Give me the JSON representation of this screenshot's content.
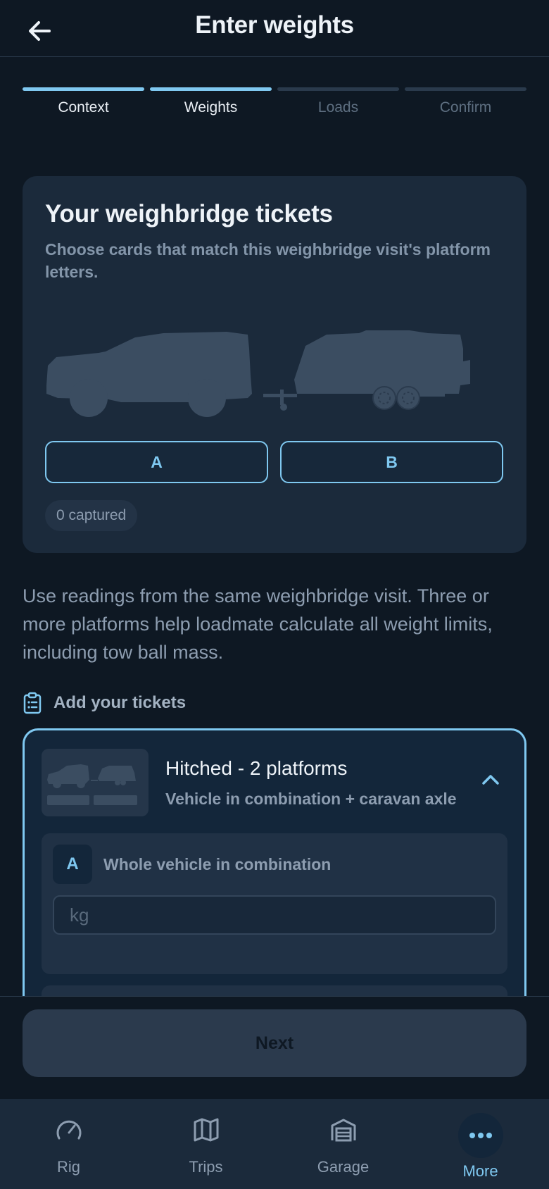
{
  "header": {
    "title": "Enter weights",
    "back_icon": "arrow-left-icon"
  },
  "stepper": {
    "steps": [
      {
        "label": "Context",
        "active": true
      },
      {
        "label": "Weights",
        "active": true
      },
      {
        "label": "Loads",
        "active": false
      },
      {
        "label": "Confirm",
        "active": false
      }
    ]
  },
  "tickets_card": {
    "title": "Your weighbridge tickets",
    "subtitle": "Choose cards that match this weighbridge visit's platform letters.",
    "platforms": [
      "A",
      "B"
    ],
    "captured": "0 captured"
  },
  "info_text": "Use readings from the same weighbridge visit. Three or more platforms help loadmate calculate all weight limits, including tow ball mass.",
  "add_tickets": {
    "label": "Add your tickets",
    "icon": "clipboard-list-icon"
  },
  "config": {
    "title": "Hitched - 2 platforms",
    "subtitle": "Vehicle in combination + caravan axle",
    "tickets": [
      {
        "letter": "A",
        "label": "Whole vehicle in combination",
        "placeholder": "kg",
        "value": ""
      }
    ]
  },
  "actions": {
    "next_label": "Next"
  },
  "nav": {
    "items": [
      {
        "label": "Rig",
        "icon": "speedometer-icon",
        "active": false
      },
      {
        "label": "Trips",
        "icon": "map-icon",
        "active": false
      },
      {
        "label": "Garage",
        "icon": "garage-icon",
        "active": false
      },
      {
        "label": "More",
        "icon": "more-dots-icon",
        "active": true
      }
    ]
  },
  "colors": {
    "accent": "#7fc8f0",
    "background": "#0e1823",
    "card": "#1b2a3b"
  }
}
